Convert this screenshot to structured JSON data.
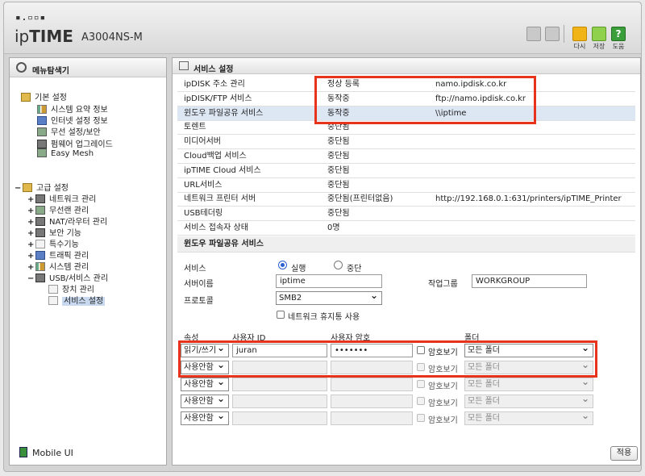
{
  "header": {
    "logo_dots": "▪.▫▫▪",
    "logo_prefix": "ip",
    "logo_bold": "TIME",
    "model": "A3004NS-M",
    "buttons": {
      "restart": "다시",
      "save": "저장",
      "help": "도움",
      "help_glyph": "?"
    },
    "colors": {
      "restart": "#f0b418",
      "save": "#8fd04c",
      "help": "#3a9f3a"
    }
  },
  "sidebar": {
    "title": "메뉴탐색기",
    "basic": {
      "label": "기본 설정",
      "items": [
        "시스템 요약 정보",
        "인터넷 설정 정보",
        "무선 설정/보안",
        "펌웨어 업그레이드",
        "Easy Mesh"
      ]
    },
    "advanced": {
      "label": "고급 설정",
      "items": [
        "네트워크 관리",
        "무선랜 관리",
        "NAT/라우터 관리",
        "보안 기능",
        "특수기능",
        "트래픽 관리",
        "시스템 관리",
        "USB/서비스 관리"
      ],
      "sub": [
        "장치 관리",
        "서비스 설정"
      ]
    },
    "mobile_ui": "Mobile UI"
  },
  "main": {
    "title": "서비스 설정",
    "services": [
      {
        "name": "ipDISK 주소 관리",
        "status": "정상 등록",
        "info": "namo.ipdisk.co.kr"
      },
      {
        "name": "ipDISK/FTP 서비스",
        "status": "동작중",
        "info": "ftp://namo.ipdisk.co.kr"
      },
      {
        "name": "윈도우 파일공유 서비스",
        "status": "동작중",
        "info": "\\\\iptime"
      },
      {
        "name": "토렌트",
        "status": "중단됨",
        "info": ""
      },
      {
        "name": "미디어서버",
        "status": "중단됨",
        "info": ""
      },
      {
        "name": "Cloud백업 서비스",
        "status": "중단됨",
        "info": ""
      },
      {
        "name": "ipTIME Cloud 서비스",
        "status": "중단됨",
        "info": ""
      },
      {
        "name": "URL서비스",
        "status": "중단됨",
        "info": ""
      },
      {
        "name": "네트워크 프린터 서버",
        "status": "중단됨(프린터없음)",
        "info": "http://192.168.0.1:631/printers/ipTIME_Printer"
      },
      {
        "name": "USB테더링",
        "status": "중단됨",
        "info": ""
      },
      {
        "name": "서비스 접속자 상태",
        "status": "0명",
        "info": ""
      }
    ],
    "smb": {
      "section_title": "윈도우 파일공유 서비스",
      "service_label": "서비스",
      "run_label": "실행",
      "stop_label": "중단",
      "server_name_label": "서버이름",
      "server_name": "iptime",
      "workgroup_label": "작업그룹",
      "workgroup": "WORKGROUP",
      "protocol_label": "프로토콜",
      "protocol": "SMB2",
      "netbios_label": "네트워크 휴지통 사용"
    },
    "accounts": {
      "headers": {
        "attr": "속성",
        "user_id": "사용자 ID",
        "password": "사용자 암호",
        "folder": "폴더"
      },
      "show_pw_label": "암호보기",
      "rows": [
        {
          "attr": "읽기/쓰기",
          "user_id": "juran",
          "password": "•••••••",
          "folder": "모든 폴더",
          "enabled": true
        },
        {
          "attr": "사용안함",
          "user_id": "",
          "password": "",
          "folder": "모든 폴더",
          "enabled": false
        },
        {
          "attr": "사용안함",
          "user_id": "",
          "password": "",
          "folder": "모든 폴더",
          "enabled": false
        },
        {
          "attr": "사용안함",
          "user_id": "",
          "password": "",
          "folder": "모든 폴더",
          "enabled": false
        },
        {
          "attr": "사용안함",
          "user_id": "",
          "password": "",
          "folder": "모든 폴더",
          "enabled": false
        }
      ]
    },
    "apply_label": "적용"
  },
  "highlight_color": "#e8331c"
}
